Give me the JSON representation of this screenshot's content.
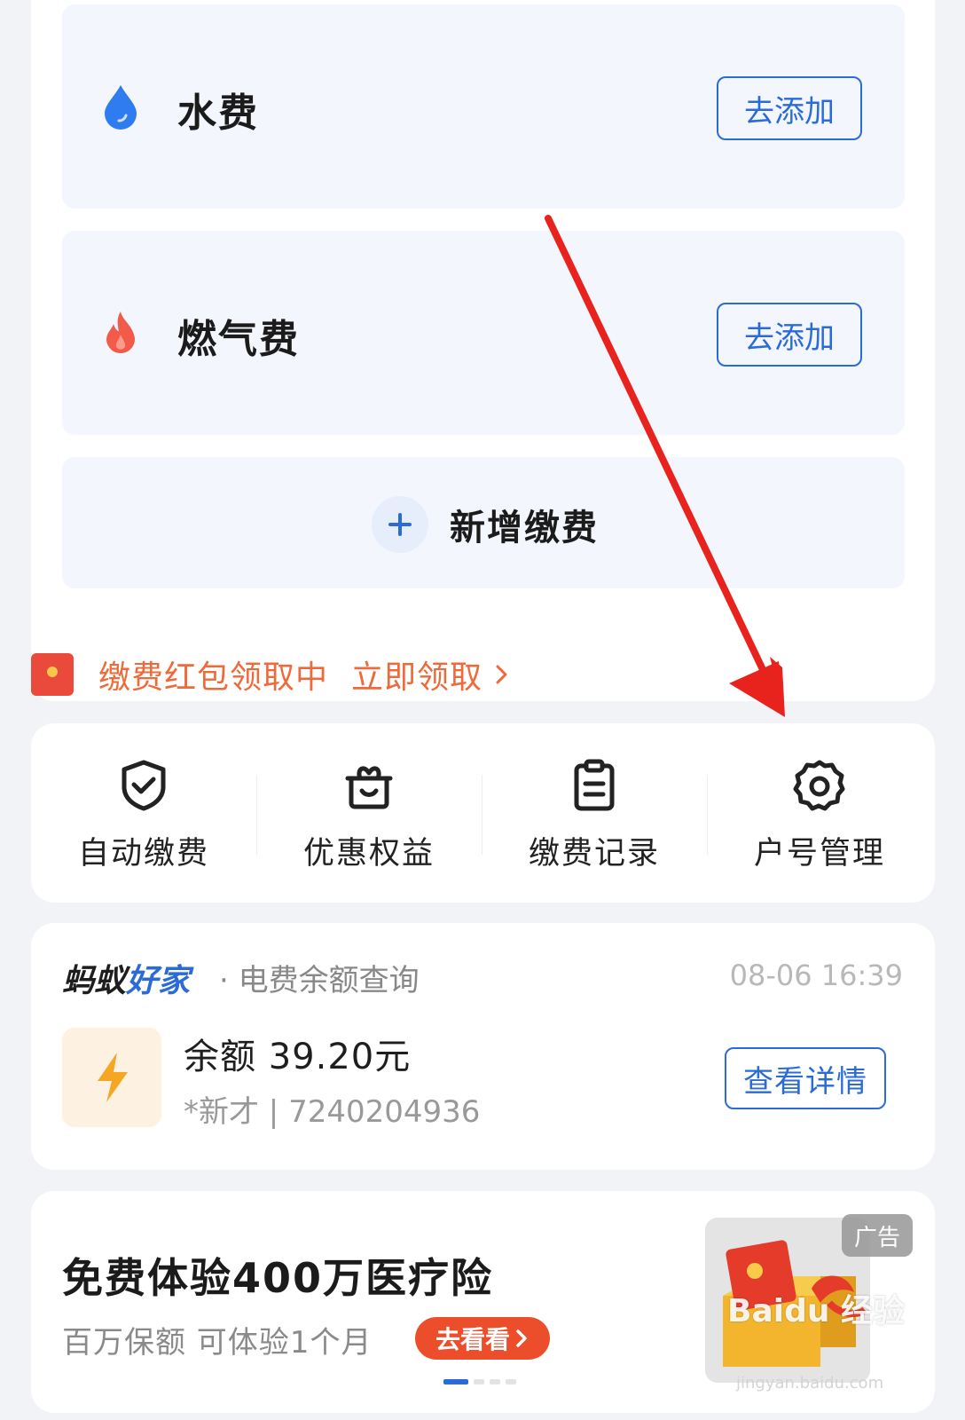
{
  "bills": [
    {
      "name": "水费",
      "icon": "water-drop-icon",
      "button": "去添加"
    },
    {
      "name": "燃气费",
      "icon": "flame-icon",
      "button": "去添加"
    }
  ],
  "add_payment": {
    "label": "新增缴费",
    "icon": "plus-icon"
  },
  "promo": {
    "text": "缴费红包领取中",
    "link": "立即领取",
    "icon": "red-packet-icon"
  },
  "menu": [
    {
      "label": "自动缴费",
      "icon": "shield-check-icon"
    },
    {
      "label": "优惠权益",
      "icon": "gift-icon"
    },
    {
      "label": "缴费记录",
      "icon": "clipboard-icon"
    },
    {
      "label": "户号管理",
      "icon": "gear-icon"
    }
  ],
  "balance": {
    "brand_part1": "蚂蚁",
    "brand_part2": "好家",
    "subtitle": "· 电费余额查询",
    "timestamp": "08-06 16:39",
    "amount": "余额 39.20元",
    "account": "*新才 | 7240204936",
    "button": "查看详情",
    "icon": "lightning-icon"
  },
  "ad": {
    "title": "免费体验400万医疗险",
    "subtitle": "百万保额 可体验1个月",
    "cta": "去看看",
    "tag": "广告"
  },
  "watermark": {
    "main": "Baidu 经验",
    "sub": "jingyan.baidu.com"
  },
  "colors": {
    "accent": "#2b6bd8",
    "promo": "#ef6a3a",
    "arrow": "#e8231d",
    "cta": "#ec4d2a"
  }
}
